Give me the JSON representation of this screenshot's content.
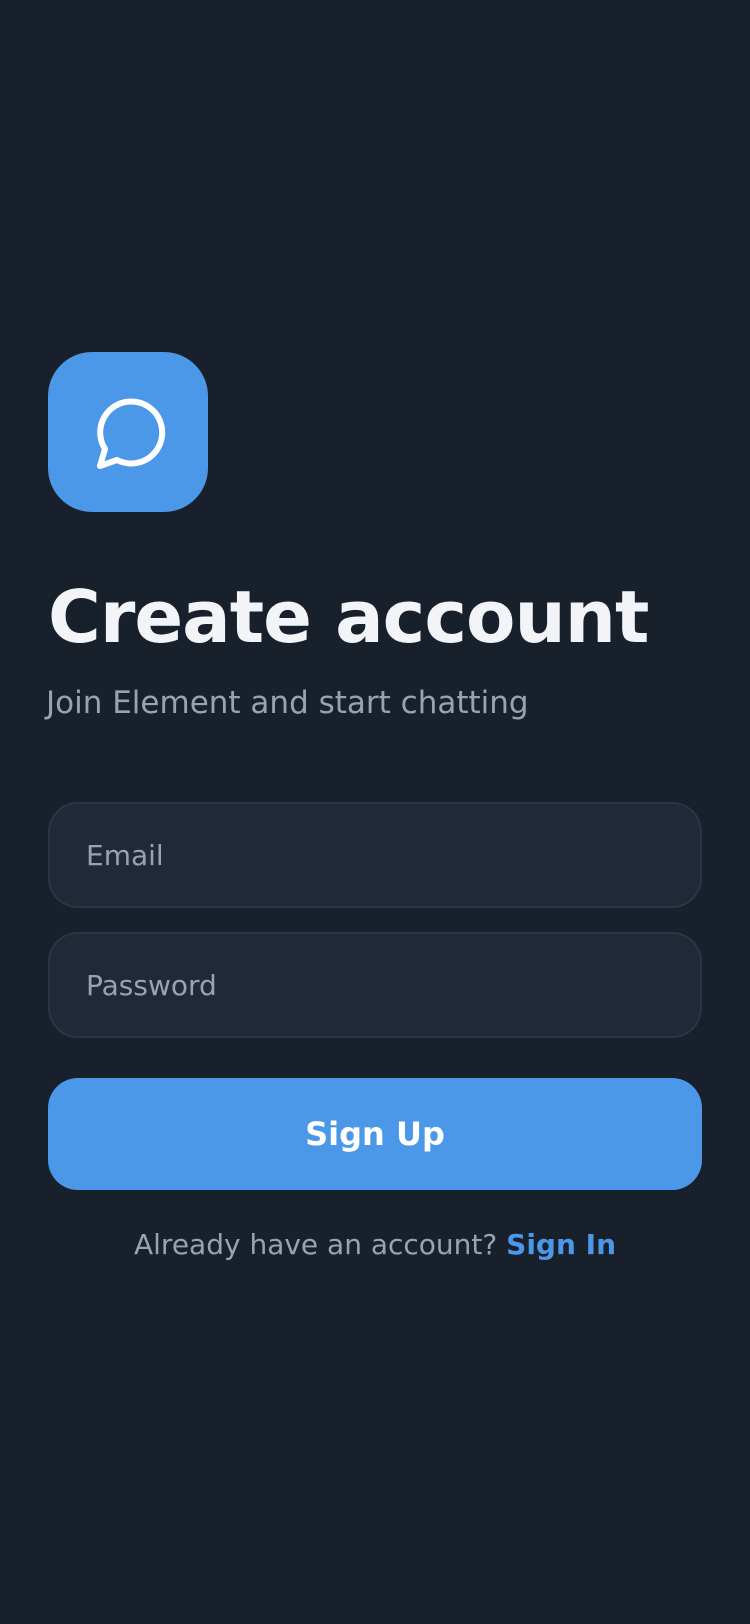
{
  "app": {
    "icon": "chat-bubble-icon",
    "accent_color": "#4c98e8",
    "background_color": "#18202c"
  },
  "header": {
    "title": "Create account",
    "subtitle": "Join Element and start chatting"
  },
  "form": {
    "email": {
      "placeholder": "Email",
      "value": ""
    },
    "password": {
      "placeholder": "Password",
      "value": ""
    },
    "submit_label": "Sign Up"
  },
  "footer": {
    "prompt": "Already have an account?",
    "link_label": "Sign In"
  }
}
